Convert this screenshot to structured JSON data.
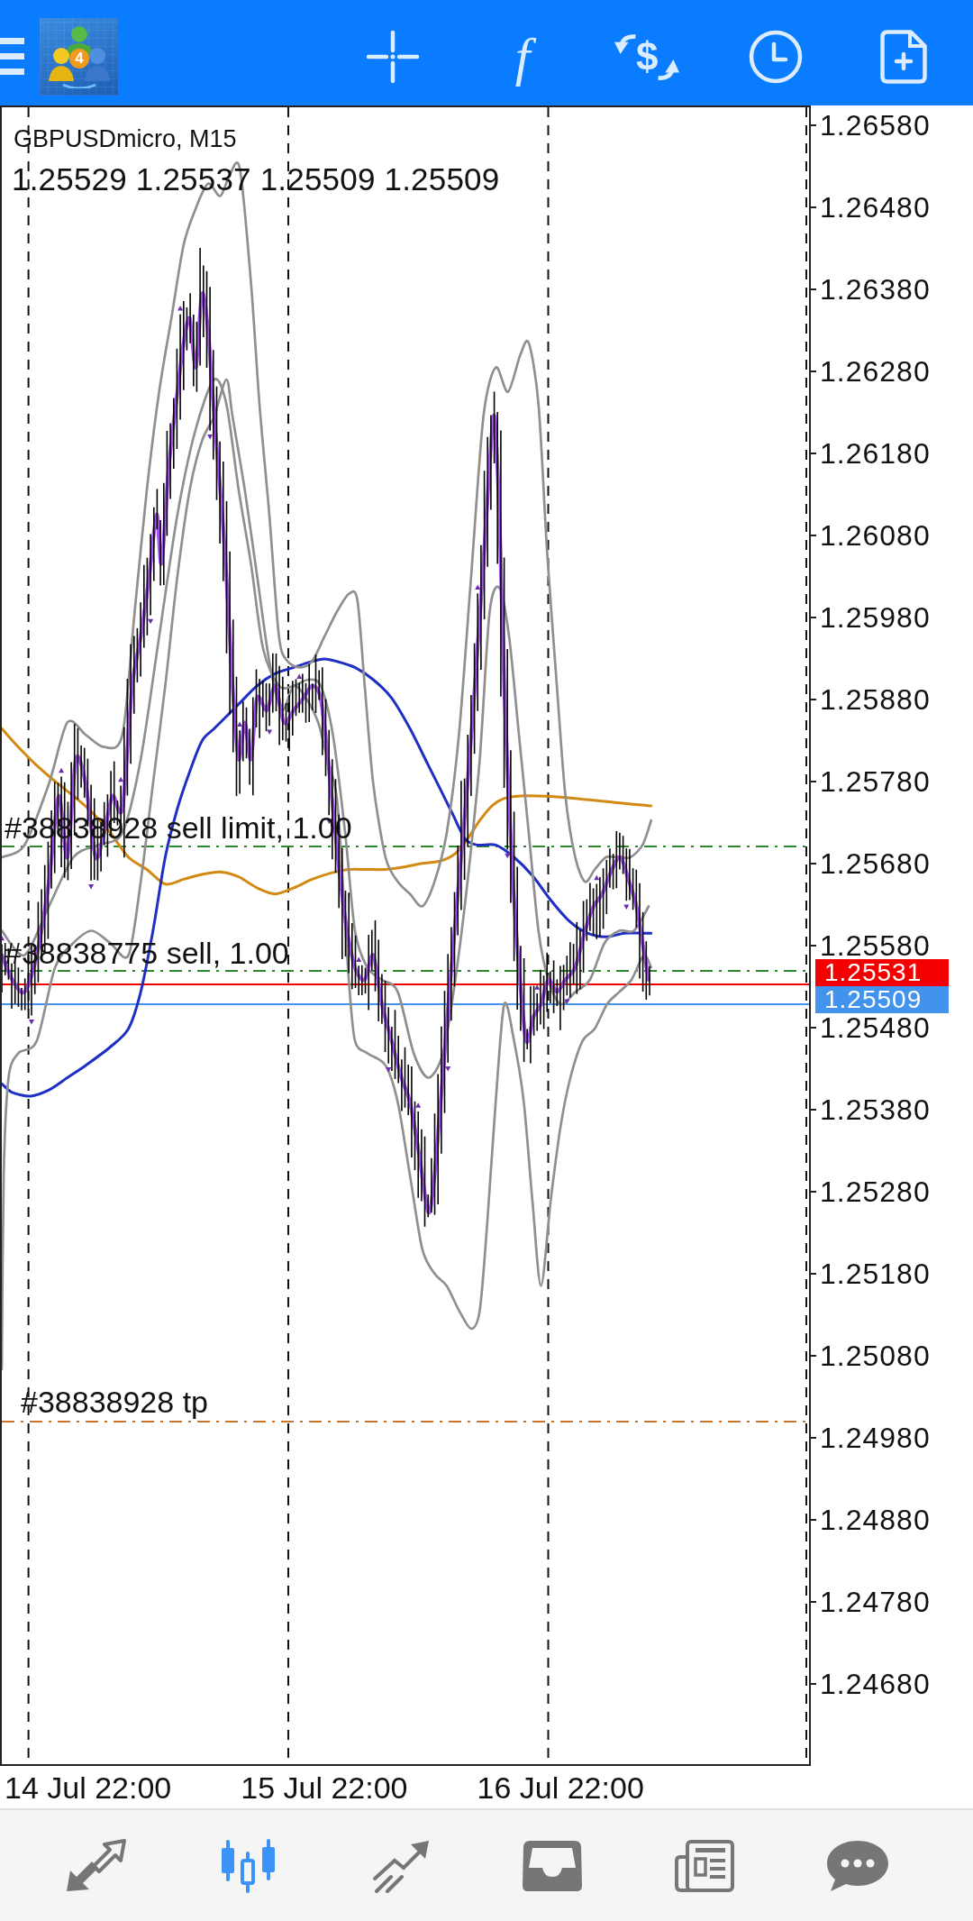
{
  "toolbar": {
    "logo_badge": "4",
    "indicators_glyph": "f",
    "trade_glyph": "$"
  },
  "chart": {
    "symbol": "GBPUSDmicro, M15",
    "ohlc": "1.25529 1.25537 1.25509 1.25509",
    "orders": [
      {
        "kind": "pending",
        "label": "#38838928 sell limit, 1.00"
      },
      {
        "kind": "position",
        "label": "#38838775 sell, 1.00"
      },
      {
        "kind": "take_profit",
        "label": "#38838928 tp"
      }
    ],
    "price_axis": [
      "1.26580",
      "1.26480",
      "1.26380",
      "1.26280",
      "1.26180",
      "1.26080",
      "1.25980",
      "1.25880",
      "1.25780",
      "1.25680",
      "1.25580",
      "1.25480",
      "1.25380",
      "1.25280",
      "1.25180",
      "1.25080",
      "1.24980",
      "1.24880",
      "1.24780",
      "1.24680"
    ],
    "price_tags": [
      {
        "text": "1.25531",
        "color": "#f50000"
      },
      {
        "text": "1.25509",
        "color": "#4193ee"
      }
    ],
    "time_axis": [
      "14 Jul 22:00",
      "15 Jul 22:00",
      "16 Jul 22:00"
    ]
  },
  "bottom_nav": [
    {
      "kind": "quotes",
      "selected": false
    },
    {
      "kind": "chart",
      "selected": true
    },
    {
      "kind": "trade",
      "selected": false
    },
    {
      "kind": "history",
      "selected": false
    },
    {
      "kind": "news",
      "selected": false
    },
    {
      "kind": "chat",
      "selected": false
    }
  ]
}
